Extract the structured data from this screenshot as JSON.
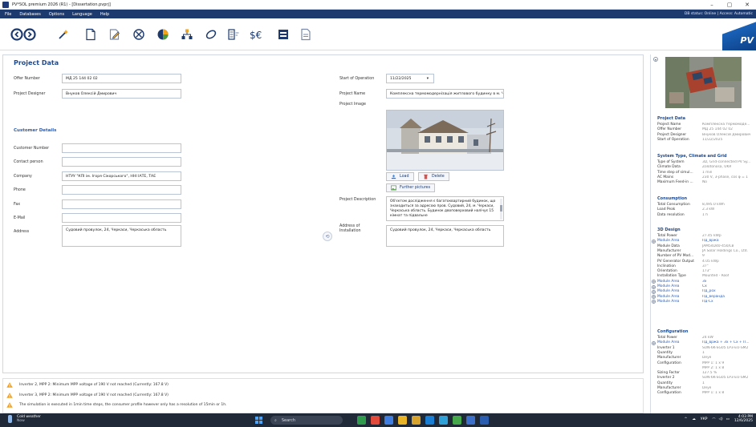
{
  "window": {
    "title": "PV*SOL premium 2026 (R1) - [Dissertation.pvprj]",
    "buttons": [
      "–",
      "▢",
      "✕"
    ]
  },
  "menu": {
    "items": [
      "File",
      "Databases",
      "Options",
      "Language",
      "Help"
    ],
    "status": "DB status: Online | Access: Automatic"
  },
  "toolbar": {
    "logo_text": "PV"
  },
  "project": {
    "heading": "Project Data",
    "offer_number_label": "Offer Number",
    "offer_number": "МД 25 144 02 02",
    "designer_label": "Project Designer",
    "designer": "Внуков Олексій Дмирович",
    "start_label": "Start of Operation",
    "start": "11/22/2025",
    "name_label": "Project Name",
    "name": "Комплексна термомодернізація житлового будинку в м. Черкаси",
    "image_label": "Project Image",
    "load_button": "Load",
    "delete_button": "Delete",
    "further_button": "Further pictures",
    "description_label": "Project Description",
    "description": "Об'єктом дослідження є багатоквартирний будинок, що знаходиться за адресою пров. Судовий, 24, м. Черкаси, Черкаська область. Будинок двоповерховий налічує 15 кімнат та підвальне",
    "address_label": "Address of Installation",
    "address": "Судовий провулок, 24, Черкаси, Черкаська область"
  },
  "customer": {
    "heading": "Customer Details",
    "number_label": "Customer Number",
    "contact_label": "Contact person",
    "company_label": "Company",
    "company": "НТУУ \"КПІ ім. Ігоря Сікорського\", ННІ ІАТЕ, ТАЕ",
    "phone_label": "Phone",
    "fax_label": "Fax",
    "email_label": "E-Mail",
    "address_label": "Address",
    "address": "Судовий провулок, 24, Черкаси, Черкаська область"
  },
  "warnings": [
    "Inverter 2, MPP 2:  Minimum MPP voltage of 190 V not reached (Currently: 167.8 V)",
    "Inverter 3, MPP 2:  Minimum MPP voltage of 190 V not reached (Currently: 167.8 V)",
    "The simulation is executed in 1min time steps, the consumer profile however only has a resolution of 15min or 1h."
  ],
  "info": {
    "project": {
      "heading": "Project Data",
      "rows": [
        [
          "Project Name",
          "Комплексна термомоде..."
        ],
        [
          "Offer Number",
          "МД 25 144 02 02"
        ],
        [
          "Project Designer",
          "Внуков Олексій Дмирович"
        ],
        [
          "Start of Operation",
          "11/22/2025"
        ]
      ]
    },
    "system": {
      "heading": "System Type, Climate and Grid",
      "rows": [
        [
          "Type of System",
          "3D, Grid-connected PV Sy..."
        ],
        [
          "Climate Data",
          "Zolotonosa, UKR"
        ],
        [
          "Time step of simul...",
          "1 min"
        ],
        [
          "AC Mains",
          "230 V, 3-phase, cos φ = 1"
        ],
        [
          "Maximum Feed-in ...",
          "No"
        ]
      ]
    },
    "consumption": {
      "heading": "Consumption",
      "rows": [
        [
          "Total Consumption",
          "8,495.0 kWh"
        ],
        [
          "Load Peak",
          "2.3 kW"
        ],
        [
          "Data resolution",
          "1 h"
        ]
      ]
    },
    "design": {
      "heading": "3D Design",
      "rows": [
        [
          "Total Power",
          "27.45 kWp"
        ],
        [
          "Module Area",
          "Пд_вржа"
        ],
        [
          "Module Data",
          "JAM54D40-450/LB"
        ],
        [
          "Manufacturer",
          "JA Solar Holdings Co., Ltd."
        ],
        [
          "Number of PV Mod...",
          "9"
        ],
        [
          "PV Generator Output",
          "4.05 kWp"
        ],
        [
          "Inclination",
          "37°"
        ],
        [
          "Orientation",
          "173°"
        ],
        [
          "Installation Type",
          "Mounted - Roof"
        ],
        [
          "Module Area",
          "Зх"
        ],
        [
          "Module Area",
          "Сх"
        ],
        [
          "Module Area",
          "Пд_рох"
        ],
        [
          "Module Area",
          "Пд_веранда"
        ],
        [
          "Module Area",
          "Пд-Сх"
        ]
      ]
    },
    "configuration": {
      "heading": "Configuration",
      "rows": [
        [
          "Total Power",
          "24 kW"
        ],
        [
          "Module Area",
          "Пд_вржа + Зх + Сх + П..."
        ],
        [
          "Inverter 1",
          "SUN-6K-SG05 LP3-EU-SM2"
        ],
        [
          "Quantity",
          "1"
        ],
        [
          "Manufacturer",
          "Deye"
        ],
        [
          "Configuration",
          "MPP 1: 1 x 9"
        ],
        [
          "",
          "MPP 2: 1 x 8"
        ],
        [
          "Sizing Factor",
          "127.5 %"
        ],
        [
          "Inverter 2",
          "SUN-6K-SG05 LP3-EU-SM2"
        ],
        [
          "Quantity",
          "1"
        ],
        [
          "Manufacturer",
          "Deye"
        ],
        [
          "Configuration",
          "MPP 1: 1 x 8"
        ]
      ]
    }
  },
  "taskbar": {
    "weather": "Cold weather",
    "weather_sub": "Now",
    "search": "Search",
    "lang": "УКР",
    "time": "4:03 PM",
    "date": "12/6/2025"
  },
  "colors": {
    "menu_bar": "#1d3a6e",
    "heading": "#1e4a8f",
    "section": "#2a5db0",
    "taskbar": "#1f2937"
  }
}
